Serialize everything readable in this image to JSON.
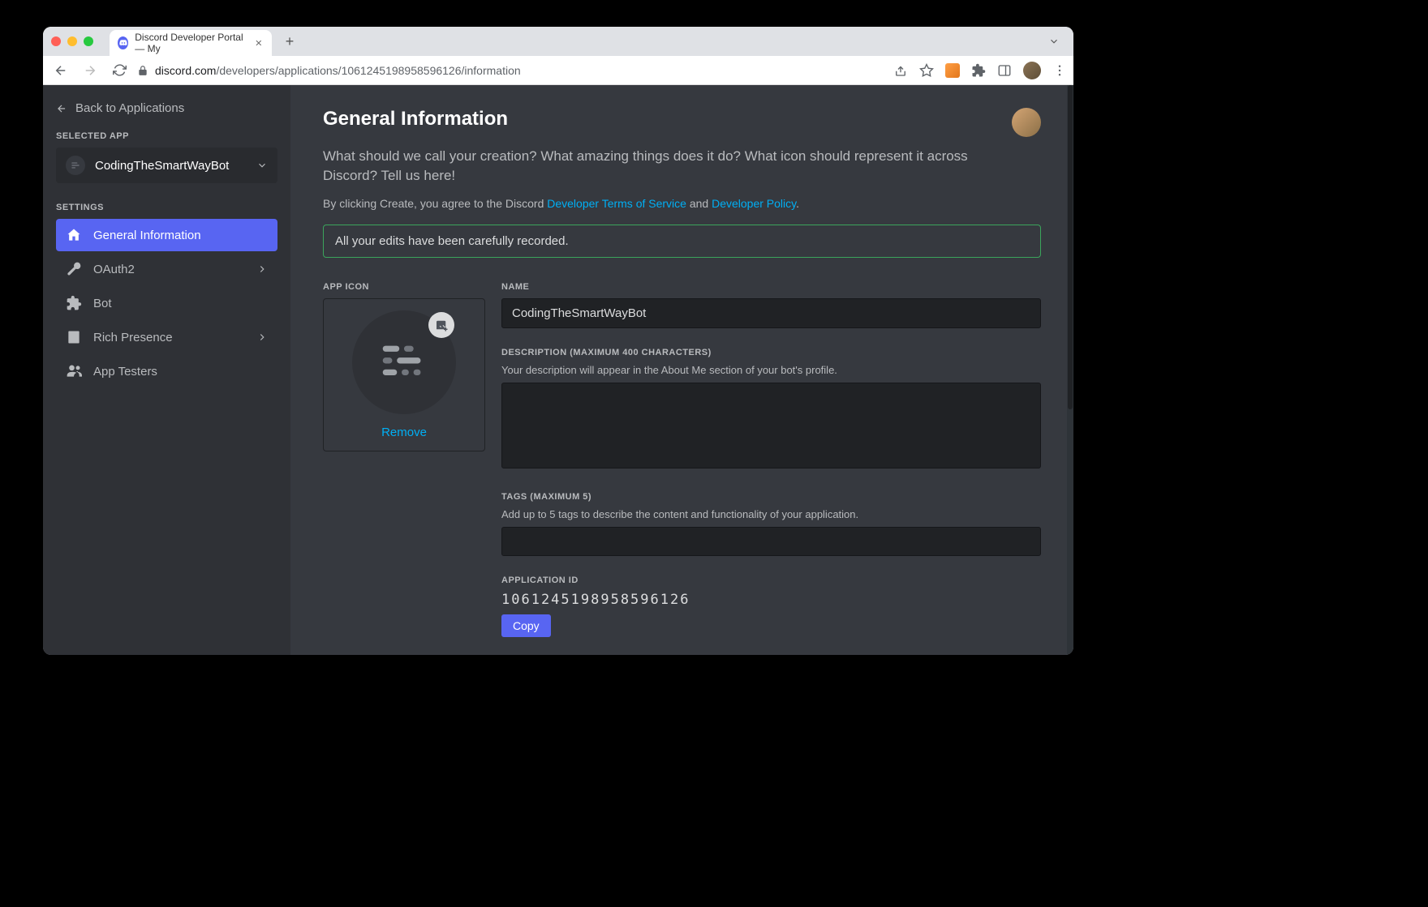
{
  "browser": {
    "tab_title": "Discord Developer Portal — My",
    "url_domain": "discord.com",
    "url_path": "/developers/applications/1061245198958596126/information"
  },
  "sidebar": {
    "back_label": "Back to Applications",
    "selected_app_header": "SELECTED APP",
    "selected_app_name": "CodingTheSmartWayBot",
    "settings_header": "SETTINGS",
    "items": [
      {
        "label": "General Information"
      },
      {
        "label": "OAuth2"
      },
      {
        "label": "Bot"
      },
      {
        "label": "Rich Presence"
      },
      {
        "label": "App Testers"
      }
    ]
  },
  "main": {
    "title": "General Information",
    "description": "What should we call your creation? What amazing things does it do? What icon should represent it across Discord? Tell us here!",
    "terms_prefix": "By clicking Create, you agree to the Discord ",
    "terms_link1": "Developer Terms of Service",
    "terms_and": " and ",
    "terms_link2": "Developer Policy",
    "terms_period": ".",
    "notice": "All your edits have been carefully recorded.",
    "app_icon_label": "APP ICON",
    "remove_label": "Remove",
    "name_label": "NAME",
    "name_value": "CodingTheSmartWayBot",
    "desc_label": "DESCRIPTION (MAXIMUM 400 CHARACTERS)",
    "desc_hint": "Your description will appear in the About Me section of your bot's profile.",
    "tags_label": "TAGS (MAXIMUM 5)",
    "tags_hint": "Add up to 5 tags to describe the content and functionality of your application.",
    "appid_label": "APPLICATION ID",
    "appid_value": "1061245198958596126",
    "copy_label": "Copy"
  }
}
